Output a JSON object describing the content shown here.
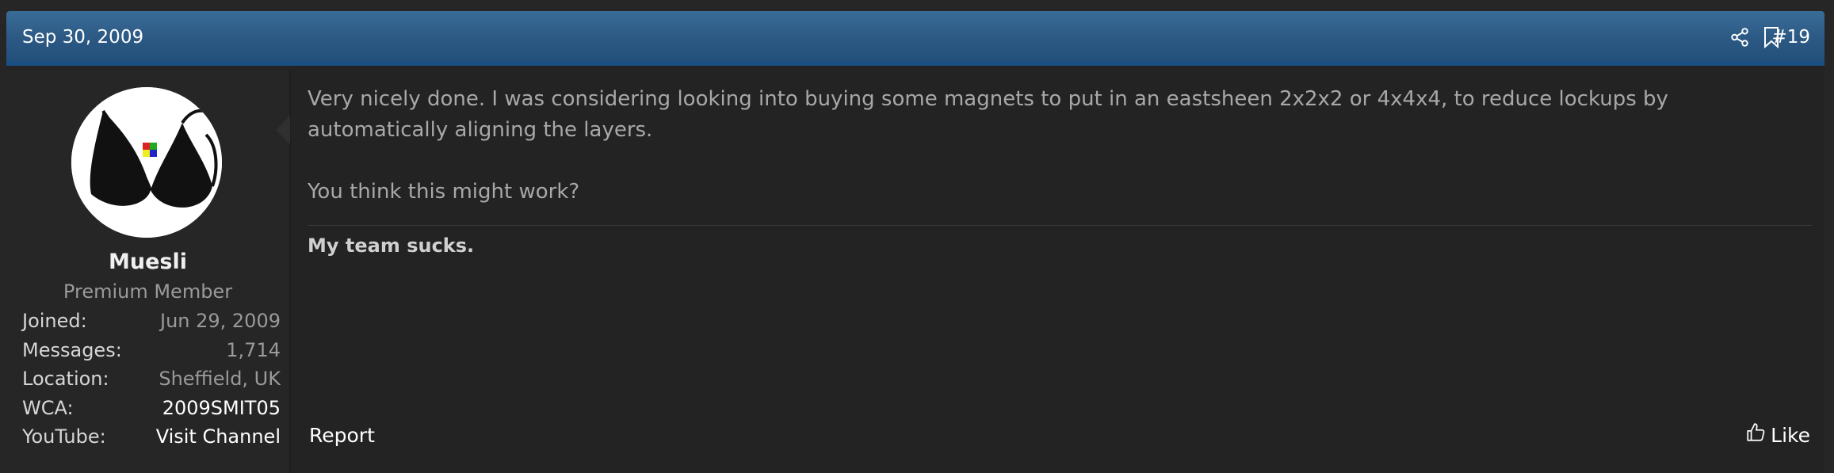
{
  "post": {
    "date": "Sep 30, 2009",
    "number": "#19",
    "header_icons": [
      "share-icon",
      "bookmark-icon"
    ]
  },
  "user": {
    "name": "Muesli",
    "title": "Premium Member",
    "stats": [
      {
        "label": "Joined:",
        "value": "Jun 29, 2009"
      },
      {
        "label": "Messages:",
        "value": "1,714"
      },
      {
        "label": "Location:",
        "value": "Sheffield, UK"
      },
      {
        "label": "WCA:",
        "value": "2009SMIT05"
      },
      {
        "label": "YouTube:",
        "value": "Visit Channel"
      }
    ]
  },
  "message": {
    "paragraph1": "Very nicely done. I was considering looking into buying some magnets to put in an eastsheen 2x2x2 or 4x4x4, to reduce lockups by automatically aligning the layers.",
    "paragraph2": "You think this might work?"
  },
  "signature": "My team sucks.",
  "actions": {
    "report": "Report",
    "like": "Like"
  },
  "colors": {
    "header": "#2b5983",
    "background": "#262626",
    "link": "#ffffff",
    "muted": "#9a9a9a"
  }
}
